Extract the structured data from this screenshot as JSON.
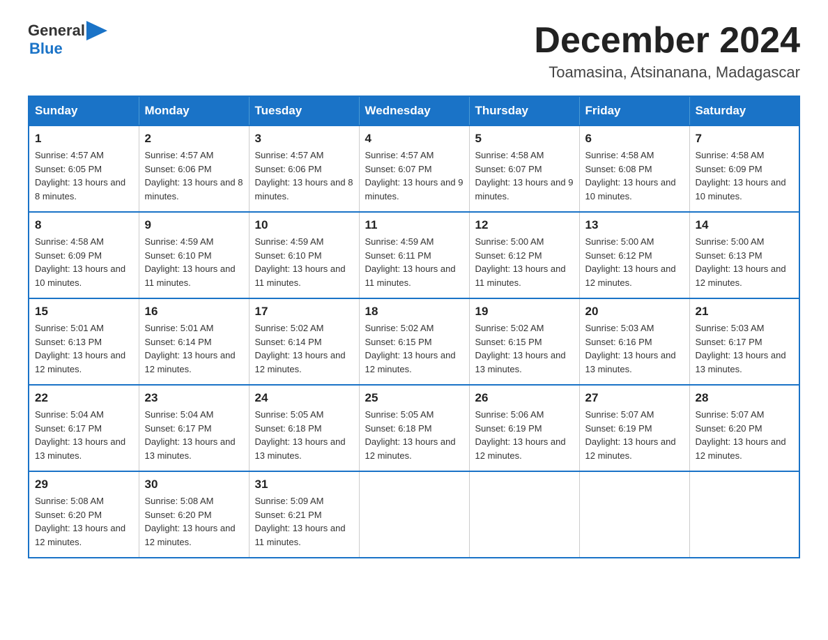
{
  "header": {
    "logo": {
      "general": "General",
      "arrow": "▶",
      "blue": "Blue"
    },
    "title": "December 2024",
    "location": "Toamasina, Atsinanana, Madagascar"
  },
  "calendar": {
    "days_of_week": [
      "Sunday",
      "Monday",
      "Tuesday",
      "Wednesday",
      "Thursday",
      "Friday",
      "Saturday"
    ],
    "weeks": [
      [
        {
          "day": "1",
          "sunrise": "4:57 AM",
          "sunset": "6:05 PM",
          "daylight": "13 hours and 8 minutes."
        },
        {
          "day": "2",
          "sunrise": "4:57 AM",
          "sunset": "6:06 PM",
          "daylight": "13 hours and 8 minutes."
        },
        {
          "day": "3",
          "sunrise": "4:57 AM",
          "sunset": "6:06 PM",
          "daylight": "13 hours and 8 minutes."
        },
        {
          "day": "4",
          "sunrise": "4:57 AM",
          "sunset": "6:07 PM",
          "daylight": "13 hours and 9 minutes."
        },
        {
          "day": "5",
          "sunrise": "4:58 AM",
          "sunset": "6:07 PM",
          "daylight": "13 hours and 9 minutes."
        },
        {
          "day": "6",
          "sunrise": "4:58 AM",
          "sunset": "6:08 PM",
          "daylight": "13 hours and 10 minutes."
        },
        {
          "day": "7",
          "sunrise": "4:58 AM",
          "sunset": "6:09 PM",
          "daylight": "13 hours and 10 minutes."
        }
      ],
      [
        {
          "day": "8",
          "sunrise": "4:58 AM",
          "sunset": "6:09 PM",
          "daylight": "13 hours and 10 minutes."
        },
        {
          "day": "9",
          "sunrise": "4:59 AM",
          "sunset": "6:10 PM",
          "daylight": "13 hours and 11 minutes."
        },
        {
          "day": "10",
          "sunrise": "4:59 AM",
          "sunset": "6:10 PM",
          "daylight": "13 hours and 11 minutes."
        },
        {
          "day": "11",
          "sunrise": "4:59 AM",
          "sunset": "6:11 PM",
          "daylight": "13 hours and 11 minutes."
        },
        {
          "day": "12",
          "sunrise": "5:00 AM",
          "sunset": "6:12 PM",
          "daylight": "13 hours and 11 minutes."
        },
        {
          "day": "13",
          "sunrise": "5:00 AM",
          "sunset": "6:12 PM",
          "daylight": "13 hours and 12 minutes."
        },
        {
          "day": "14",
          "sunrise": "5:00 AM",
          "sunset": "6:13 PM",
          "daylight": "13 hours and 12 minutes."
        }
      ],
      [
        {
          "day": "15",
          "sunrise": "5:01 AM",
          "sunset": "6:13 PM",
          "daylight": "13 hours and 12 minutes."
        },
        {
          "day": "16",
          "sunrise": "5:01 AM",
          "sunset": "6:14 PM",
          "daylight": "13 hours and 12 minutes."
        },
        {
          "day": "17",
          "sunrise": "5:02 AM",
          "sunset": "6:14 PM",
          "daylight": "13 hours and 12 minutes."
        },
        {
          "day": "18",
          "sunrise": "5:02 AM",
          "sunset": "6:15 PM",
          "daylight": "13 hours and 12 minutes."
        },
        {
          "day": "19",
          "sunrise": "5:02 AM",
          "sunset": "6:15 PM",
          "daylight": "13 hours and 13 minutes."
        },
        {
          "day": "20",
          "sunrise": "5:03 AM",
          "sunset": "6:16 PM",
          "daylight": "13 hours and 13 minutes."
        },
        {
          "day": "21",
          "sunrise": "5:03 AM",
          "sunset": "6:17 PM",
          "daylight": "13 hours and 13 minutes."
        }
      ],
      [
        {
          "day": "22",
          "sunrise": "5:04 AM",
          "sunset": "6:17 PM",
          "daylight": "13 hours and 13 minutes."
        },
        {
          "day": "23",
          "sunrise": "5:04 AM",
          "sunset": "6:17 PM",
          "daylight": "13 hours and 13 minutes."
        },
        {
          "day": "24",
          "sunrise": "5:05 AM",
          "sunset": "6:18 PM",
          "daylight": "13 hours and 13 minutes."
        },
        {
          "day": "25",
          "sunrise": "5:05 AM",
          "sunset": "6:18 PM",
          "daylight": "13 hours and 12 minutes."
        },
        {
          "day": "26",
          "sunrise": "5:06 AM",
          "sunset": "6:19 PM",
          "daylight": "13 hours and 12 minutes."
        },
        {
          "day": "27",
          "sunrise": "5:07 AM",
          "sunset": "6:19 PM",
          "daylight": "13 hours and 12 minutes."
        },
        {
          "day": "28",
          "sunrise": "5:07 AM",
          "sunset": "6:20 PM",
          "daylight": "13 hours and 12 minutes."
        }
      ],
      [
        {
          "day": "29",
          "sunrise": "5:08 AM",
          "sunset": "6:20 PM",
          "daylight": "13 hours and 12 minutes."
        },
        {
          "day": "30",
          "sunrise": "5:08 AM",
          "sunset": "6:20 PM",
          "daylight": "13 hours and 12 minutes."
        },
        {
          "day": "31",
          "sunrise": "5:09 AM",
          "sunset": "6:21 PM",
          "daylight": "13 hours and 11 minutes."
        },
        null,
        null,
        null,
        null
      ]
    ]
  }
}
